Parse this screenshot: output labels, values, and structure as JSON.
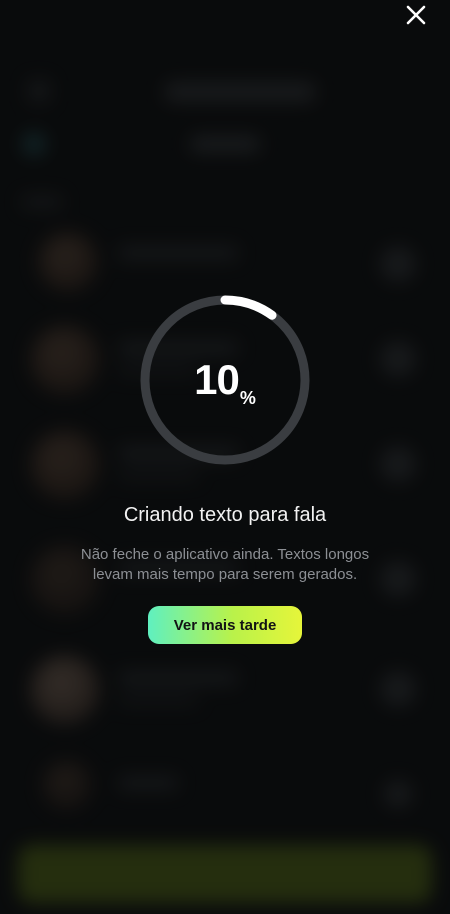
{
  "dialog": {
    "close_icon": "close-icon",
    "progress": {
      "value": 10,
      "display_number": "10",
      "unit": "%",
      "track_color": "#3a3d41",
      "fill_color": "#ffffff"
    },
    "title": "Criando texto para fala",
    "subtitle": "Não feche o aplicativo ainda. Textos longos levam mais tempo para serem gerados.",
    "later_button_label": "Ver mais tarde",
    "later_button_gradient": [
      "#5ff0c0",
      "#b9f24a",
      "#e6f53a"
    ]
  },
  "colors": {
    "background": "#0d0e10",
    "bottom_button_blurred": "#7a9a1a"
  }
}
